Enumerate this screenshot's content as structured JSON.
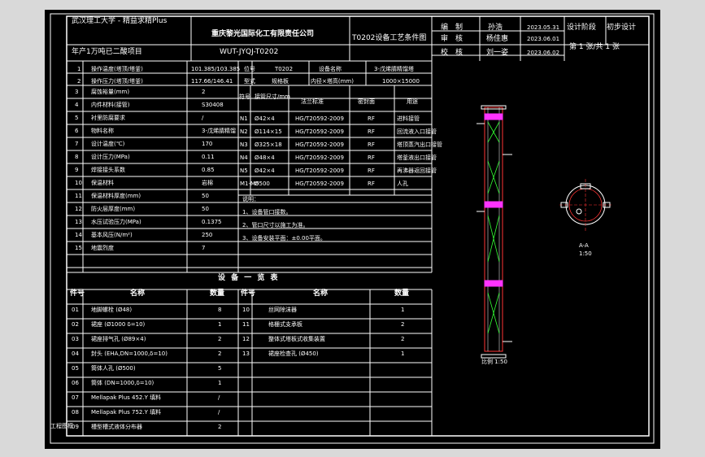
{
  "colors": {
    "background": "#000000",
    "lines": "#ffffff",
    "frame_outside": "#d9d9d9",
    "accent_red": "#ff3333",
    "accent_magenta": "#ff33ff",
    "accent_green": "#33ff33"
  },
  "title_block": {
    "university": "武汉理工大学 - 精益求精Plus",
    "company": "重庆黎光国际化工有限责任公司",
    "drawing_title": "T0202设备工艺条件图",
    "project": "年产1万吨已二酸项目",
    "drawing_no": "WUT-JYQJ-T0202",
    "sign_rows": [
      {
        "role": "编　制",
        "name": "孙浩",
        "date": "2023.05.31"
      },
      {
        "role": "审　核",
        "name": "杨佳惠",
        "date": "2023.06.01"
      },
      {
        "role": "校　核",
        "name": "刘一姿",
        "date": "2023.06.02"
      }
    ],
    "stage_label": "设计阶段",
    "stage_value": "初步设计",
    "sheet_text": "第 1 张/共 1 张"
  },
  "process_table": {
    "header_row1": [
      "1",
      "操作温度(塔顶/塔釜)",
      "101.385/103.385",
      "位号",
      "T0202",
      "设备名称",
      "3-戊烯腈精馏塔"
    ],
    "header_row2": [
      "2",
      "操作压力(塔顶/塔釜)",
      "117.66/146.41",
      "型式",
      "规格板",
      "内径×塔高(mm)",
      "1000×15000"
    ],
    "rows": [
      [
        "3",
        "腐蚀裕量(mm)",
        "2"
      ],
      [
        "4",
        "内件材料(接管)",
        "S30408"
      ],
      [
        "5",
        "衬里防腐要求",
        "/"
      ],
      [
        "6",
        "物料名称",
        "3-戊烯腈精馏"
      ],
      [
        "7",
        "设计温度(℃)",
        "170"
      ],
      [
        "8",
        "设计压力(MPa)",
        "0.11"
      ],
      [
        "9",
        "焊接接头系数",
        "0.85"
      ],
      [
        "10",
        "保温材料",
        "岩棉"
      ],
      [
        "11",
        "保温材料厚度(mm)",
        "50"
      ],
      [
        "12",
        "防火层厚度(mm)",
        "50"
      ],
      [
        "13",
        "水压试验压力(MPa)",
        "0.1375"
      ],
      [
        "14",
        "基本风压(N/m²)",
        "250"
      ],
      [
        "15",
        "地震烈度",
        "7"
      ]
    ],
    "nozzle_header": [
      "符号",
      "接管尺寸/mm",
      "法兰标准",
      "密封面",
      "用途"
    ],
    "nozzles": [
      [
        "N1",
        "Ø42×4",
        "HG/T20592-2009",
        "RF",
        "进料接管"
      ],
      [
        "N2",
        "Ø114×15",
        "HG/T20592-2009",
        "RF",
        "回流液入口接管"
      ],
      [
        "N3",
        "Ø325×18",
        "HG/T20592-2009",
        "RF",
        "塔顶蒸汽出口接管"
      ],
      [
        "N4",
        "Ø48×4",
        "HG/T20592-2009",
        "RF",
        "塔釜液出口接管"
      ],
      [
        "N5",
        "Ø42×4",
        "HG/T20592-2009",
        "RF",
        "再沸器返回接管"
      ],
      [
        "M1-M5",
        "Ø500",
        "HG/T20592-2009",
        "RF",
        "人孔"
      ]
    ],
    "notes_title": "说明：",
    "notes": [
      "1、设备管口接数。",
      "2、管口尺寸以施工为准。",
      "3、设备安装平面：±0.00平面。"
    ]
  },
  "parts_list": {
    "title": "设 备 一 览 表",
    "headers": [
      "件号",
      "名称",
      "数量",
      "件号",
      "名称",
      "数量"
    ],
    "left": [
      [
        "01",
        "地脚螺栓 (Ø48)",
        "8"
      ],
      [
        "02",
        "裙座 (Ø1000 δ=10)",
        "1"
      ],
      [
        "03",
        "裙座排气孔 (Ø89×4)",
        "2"
      ],
      [
        "04",
        "封头 (EHA,DN=1000,δ=10)",
        "2"
      ],
      [
        "05",
        "筒体人孔 (Ø500)",
        "5"
      ],
      [
        "06",
        "筒体 (DN=1000,δ=10)",
        "1"
      ],
      [
        "07",
        "Mellapak Plus 452.Y 填料",
        "/"
      ],
      [
        "08",
        "Mellapak Plus 752.Y 填料",
        "/"
      ],
      [
        "09",
        "槽型槽式液体分布器",
        "2"
      ]
    ],
    "right": [
      [
        "10",
        "丝网除沫器",
        "1"
      ],
      [
        "11",
        "格栅式支承板",
        "2"
      ],
      [
        "12",
        "整体式塔板式收集装置",
        "2"
      ],
      [
        "13",
        "裙座检查孔 (Ø450)",
        "1"
      ]
    ]
  },
  "views": {
    "elevation_caption": "比例 1:50",
    "section_caption": "A-A",
    "section_scale": "1:50"
  },
  "corner_label": "工程图框"
}
